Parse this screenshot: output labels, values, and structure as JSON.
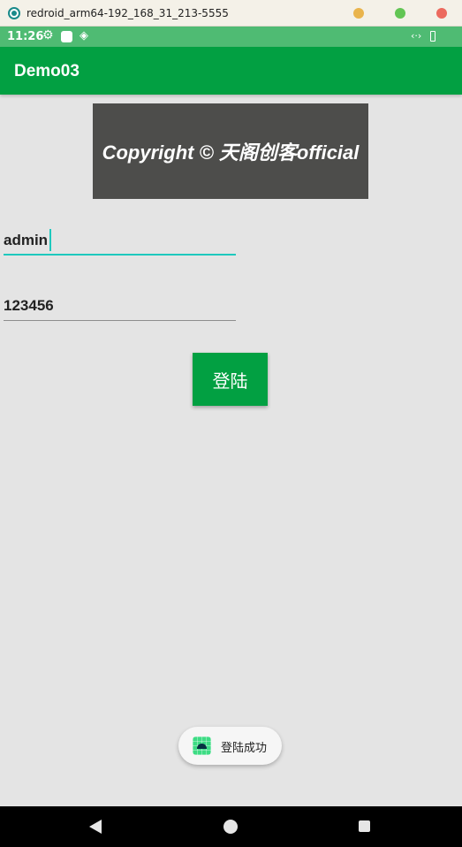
{
  "window": {
    "title": "redroid_arm64-192_168_31_213-5555",
    "icon": "app-logo-icon",
    "controls": [
      "minimize-button",
      "maximize-button",
      "close-button"
    ]
  },
  "status_bar": {
    "time": "11:26",
    "icons": [
      "gear-icon",
      "notification-square-icon",
      "signal-icon",
      "network-icon",
      "battery-icon"
    ],
    "net_glyph": "‹·›"
  },
  "action_bar": {
    "title": "Demo03",
    "color": "#02a042"
  },
  "banner": {
    "text": "Copyright © 天阁创客official"
  },
  "form": {
    "username": "admin",
    "password": "123456",
    "login_label": "登陆"
  },
  "toast": {
    "message": "登陆成功",
    "icon": "android-icon"
  },
  "nav_bar": {
    "buttons": [
      "back-button",
      "home-button",
      "recents-button"
    ]
  },
  "colors": {
    "accent": "#02a042",
    "status_bar": "#4fbb73",
    "focus_line": "#1ec8bd",
    "banner_bg": "#4d4d4b",
    "background": "#e4e4e4"
  }
}
